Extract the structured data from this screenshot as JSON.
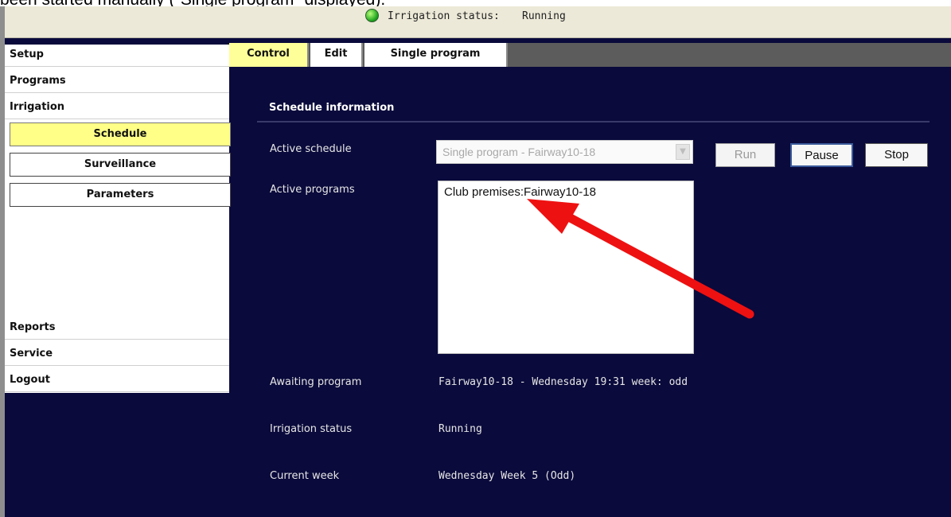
{
  "caption": "been started manually (\"Single program\" displayed).",
  "status": {
    "label": "Irrigation status:",
    "value": "Running",
    "indicator_color": "#1fa51f"
  },
  "sidebar": {
    "items": [
      {
        "label": "Setup"
      },
      {
        "label": "Programs"
      },
      {
        "label": "Irrigation"
      },
      {
        "label": "Reports"
      },
      {
        "label": "Service"
      },
      {
        "label": "Logout"
      }
    ],
    "subitems": [
      {
        "label": "Schedule",
        "active": true
      },
      {
        "label": "Surveillance",
        "active": false
      },
      {
        "label": "Parameters",
        "active": false
      }
    ]
  },
  "tabs": [
    {
      "label": "Control",
      "active": true
    },
    {
      "label": "Edit",
      "active": false
    },
    {
      "label": "Single program",
      "active": false
    }
  ],
  "schedule": {
    "title": "Schedule information",
    "active_schedule_label": "Active schedule",
    "active_schedule_value": "Single program - Fairway10-18",
    "active_programs_label": "Active programs",
    "active_programs": [
      "Club premises:Fairway10-18"
    ],
    "awaiting_program_label": "Awaiting program",
    "awaiting_program_value": "Fairway10-18 - Wednesday 19:31 week: odd",
    "irrigation_status_label": "Irrigation status",
    "irrigation_status_value": "Running",
    "current_week_label": "Current week",
    "current_week_value": "Wednesday Week 5 (Odd)"
  },
  "buttons": {
    "run": "Run",
    "pause": "Pause",
    "stop": "Stop"
  },
  "annotation": {
    "color": "#ee1111"
  }
}
